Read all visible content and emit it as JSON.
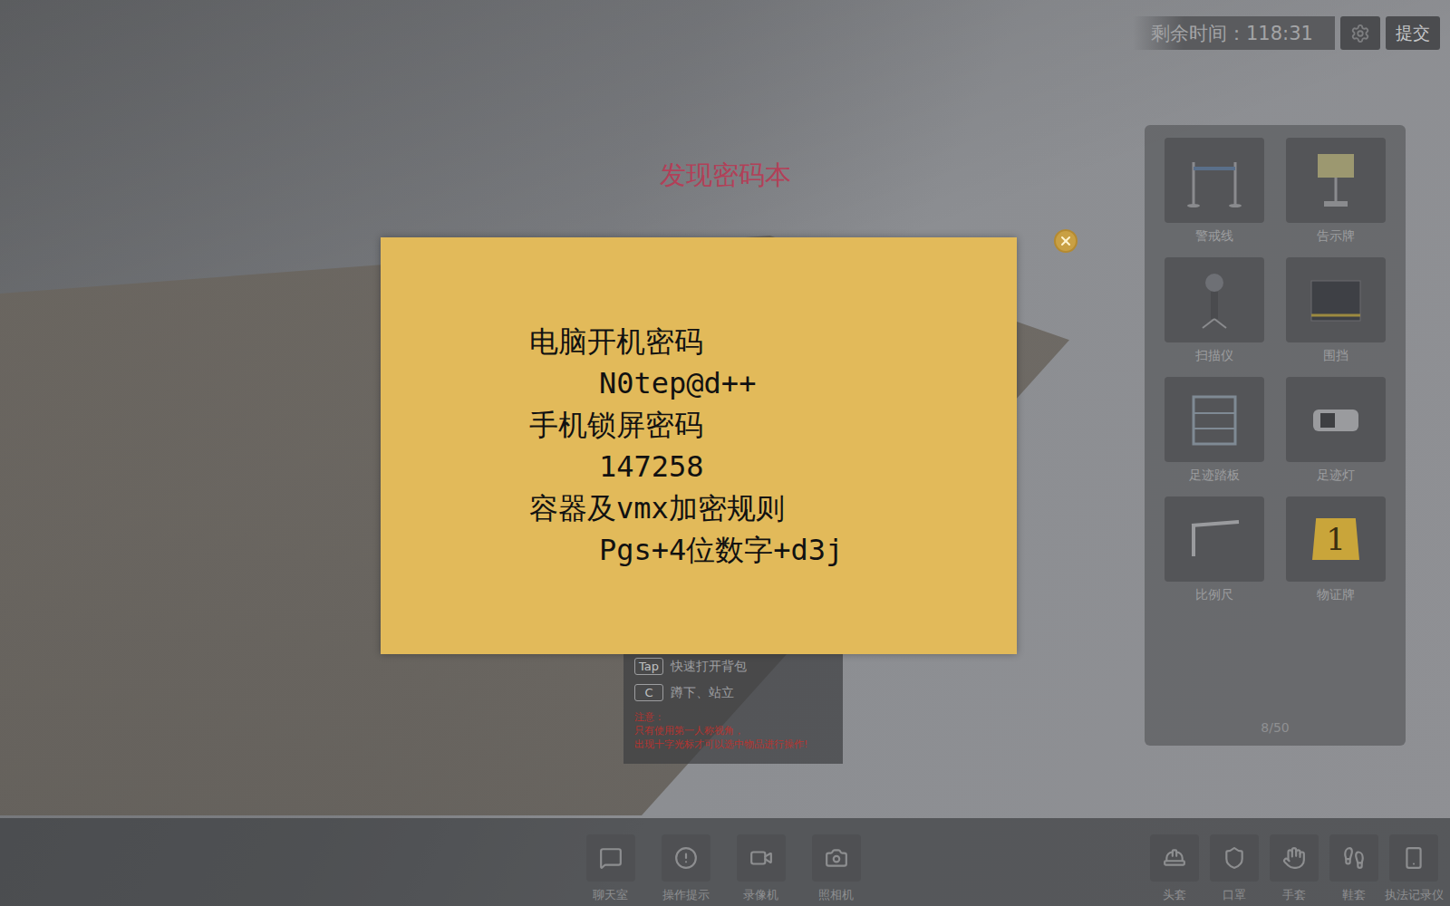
{
  "hud": {
    "timer_label": "剩余时间：",
    "timer": "118:31",
    "submit": "提交"
  },
  "notice": "发现密码本",
  "note": {
    "lines": [
      {
        "text": "电脑开机密码",
        "indent": false
      },
      {
        "text": "N0tep@d++",
        "indent": true
      },
      {
        "text": "手机锁屏密码",
        "indent": false
      },
      {
        "text": "147258",
        "indent": true
      },
      {
        "text": "容器及vmx加密规则",
        "indent": false
      },
      {
        "text": "Pgs+4位数字+d3j",
        "indent": true
      }
    ]
  },
  "tools": [
    {
      "label": "警戒线"
    },
    {
      "label": "告示牌"
    },
    {
      "label": "扫描仪"
    },
    {
      "label": "围挡"
    },
    {
      "label": "足迹踏板"
    },
    {
      "label": "足迹灯"
    },
    {
      "label": "比例尺"
    },
    {
      "label": "物证牌",
      "marker": "1"
    }
  ],
  "tool_count": "8/50",
  "hints": [
    {
      "key": "Tap",
      "text": "快速打开背包"
    },
    {
      "key": "C",
      "text": "蹲下、站立"
    }
  ],
  "warning": [
    "注意：",
    "只有使用第一人称视角，",
    "出现十字光标才可以选中物品进行操作!"
  ],
  "toolbar": [
    {
      "label": "聊天室"
    },
    {
      "label": "操作提示"
    },
    {
      "label": "录像机"
    },
    {
      "label": "照相机"
    }
  ],
  "protection": [
    {
      "label": "头套"
    },
    {
      "label": "口罩"
    },
    {
      "label": "手套"
    },
    {
      "label": "鞋套"
    },
    {
      "label": "执法记录仪"
    }
  ]
}
